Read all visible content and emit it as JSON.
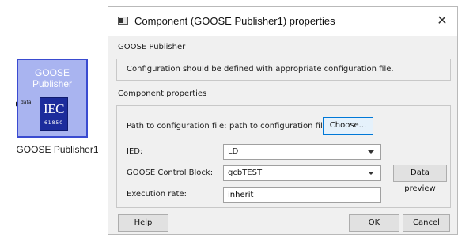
{
  "block": {
    "title_line1": "GOOSE",
    "title_line2": "Publisher",
    "logo_text": "IEC",
    "logo_number": "61850",
    "port_label": "data",
    "caption": "GOOSE Publisher1",
    "fill_color": "#a9b4f0",
    "border_color": "#3a4bd0"
  },
  "dialog": {
    "title": "Component (GOOSE Publisher1) properties",
    "icons": {
      "app": "window-icon",
      "close": "close-icon"
    },
    "close_glyph": "✕",
    "description_section_label": "GOOSE Publisher",
    "description_text": "Configuration should be defined with appropriate configuration file.",
    "properties_section_label": "Component properties",
    "config_file": {
      "label": "Path to configuration file:",
      "value": "path to configuration file",
      "button": "Choose..."
    },
    "ied": {
      "label": "IED:",
      "value": "LD"
    },
    "goose_control_block": {
      "label": "GOOSE Control Block:",
      "value": "gcbTEST",
      "button": "Data preview"
    },
    "execution_rate": {
      "label": "Execution rate:",
      "value": "inherit"
    },
    "buttons": {
      "help": "Help",
      "ok": "OK",
      "cancel": "Cancel"
    }
  }
}
